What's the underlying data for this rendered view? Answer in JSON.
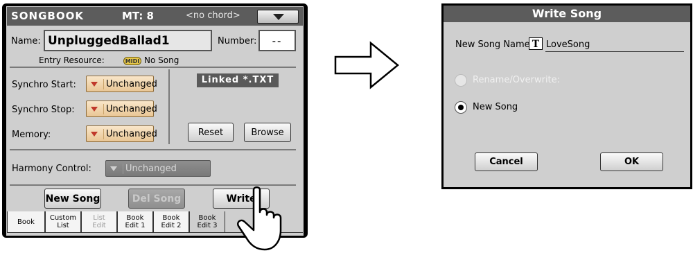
{
  "songbook": {
    "title": "SONGBOOK",
    "meter": "MT: 8",
    "chord": "<no chord>",
    "name_label": "Name:",
    "name_value": "UnpluggedBallad1",
    "number_label": "Number:",
    "number_value": "--",
    "entry_resource_label": "Entry Resource:",
    "midi_badge": "MIDI",
    "entry_resource_value": "No Song",
    "synchro_start_label": "Synchro Start:",
    "synchro_start_value": "Unchanged",
    "synchro_stop_label": "Synchro Stop:",
    "synchro_stop_value": "Unchanged",
    "memory_label": "Memory:",
    "memory_value": "Unchanged",
    "linked_txt": "Linked *.TXT",
    "reset_label": "Reset",
    "browse_label": "Browse",
    "harmony_control_label": "Harmony Control:",
    "harmony_control_value": "Unchanged",
    "new_song_label": "New Song",
    "del_song_label": "Del Song",
    "write_label": "Write",
    "tabs": [
      {
        "line1": "Book",
        "line2": ""
      },
      {
        "line1": "Custom",
        "line2": "List"
      },
      {
        "line1": "List",
        "line2": "Edit"
      },
      {
        "line1": "Book",
        "line2": "Edit 1"
      },
      {
        "line1": "Book",
        "line2": "Edit 2"
      },
      {
        "line1": "Book",
        "line2": "Edit 3"
      }
    ]
  },
  "write_dialog": {
    "title": "Write Song",
    "new_song_name_label": "New Song Name:",
    "text_icon": "T",
    "new_song_name_value": "LoveSong",
    "rename_option": "Rename/Overwrite:",
    "new_song_option": "New Song",
    "cancel_label": "Cancel",
    "ok_label": "OK"
  },
  "icons": {
    "menu": "chevron-down-icon",
    "transition": "right-arrow-icon",
    "pointer": "hand-pointer-icon",
    "text_edit": "text-edit-icon"
  },
  "colors": {
    "header": "#5c5c5c",
    "panel": "#cfcfcf",
    "dropdown_fill": "#e9c695",
    "dropdown_arrow": "#c0392b",
    "midi_badge": "#e8c84a"
  }
}
